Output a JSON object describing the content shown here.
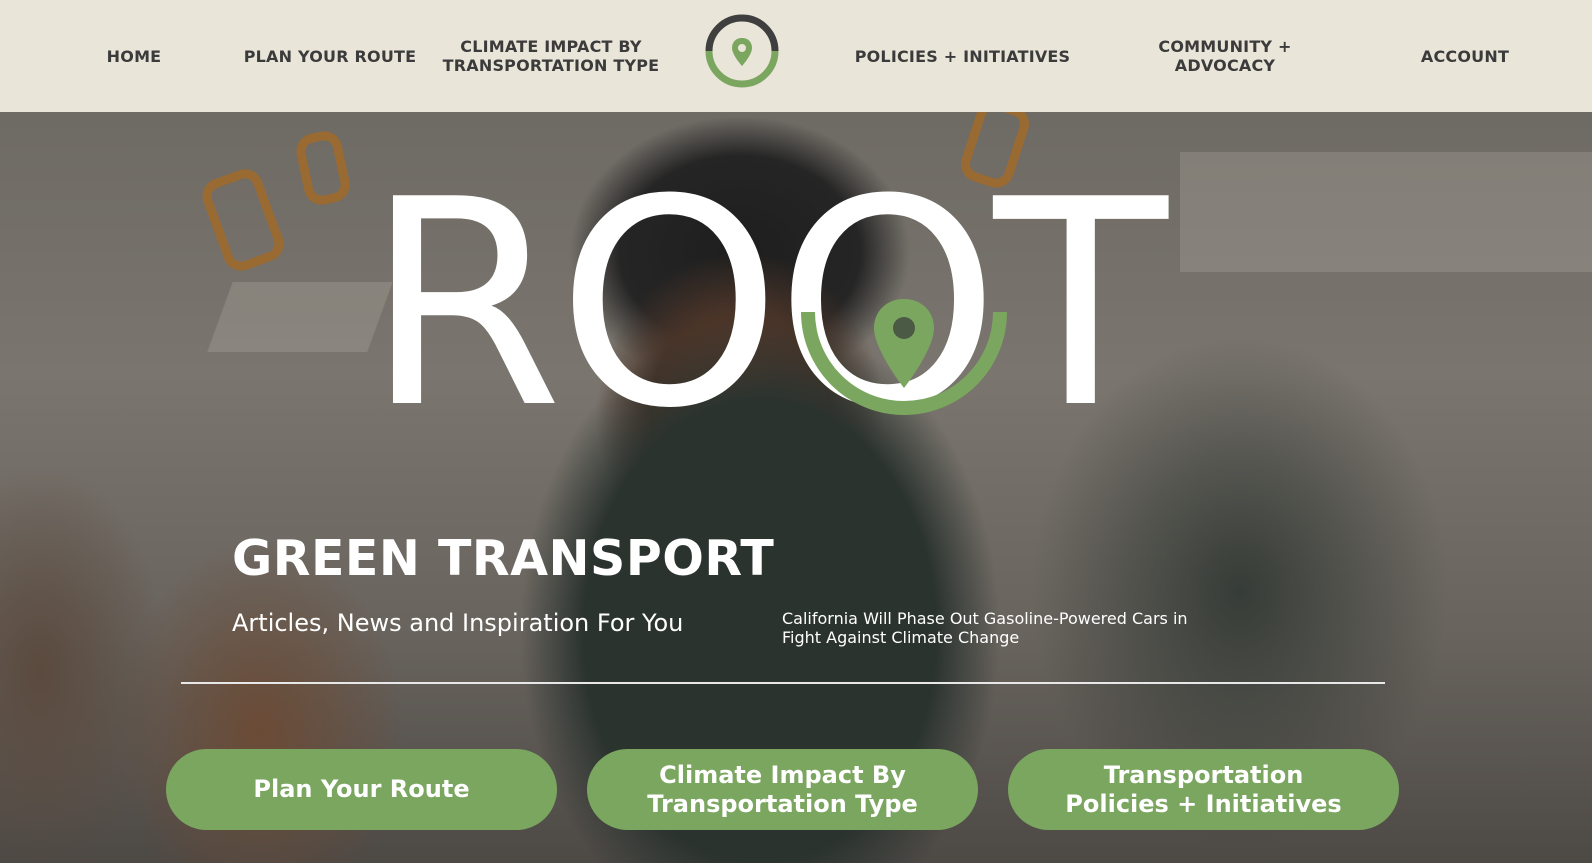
{
  "nav": {
    "items": [
      {
        "id": "home",
        "label": "HOME"
      },
      {
        "id": "plan",
        "label": "PLAN YOUR ROUTE"
      },
      {
        "id": "climate",
        "label": "CLIMATE IMPACT BY TRANSPORTATION TYPE"
      },
      {
        "id": "policies",
        "label": "POLICIES + INITIATIVES"
      },
      {
        "id": "community",
        "label": "COMMUNITY + ADVOCACY"
      },
      {
        "id": "account",
        "label": "ACCOUNT"
      }
    ],
    "logo_icon": "location-pin-ring-icon"
  },
  "hero": {
    "brand": "ROOT",
    "brand_icon": "location-pin-icon",
    "title": "GREEN TRANSPORT",
    "subtitle": "Articles, News and Inspiration For You",
    "headline": "California Will Phase Out Gasoline-Powered Cars in Fight Against Climate Change"
  },
  "cta": {
    "plan": "Plan Your Route",
    "climate": "Climate Impact By Transportation Type",
    "policies": "Transportation Policies + Initiatives"
  },
  "colors": {
    "accent_green": "#7ba660",
    "nav_bg": "#e9e5d9",
    "nav_text": "#3b3b3b",
    "logo_ring_dark": "#3f3f3f"
  }
}
